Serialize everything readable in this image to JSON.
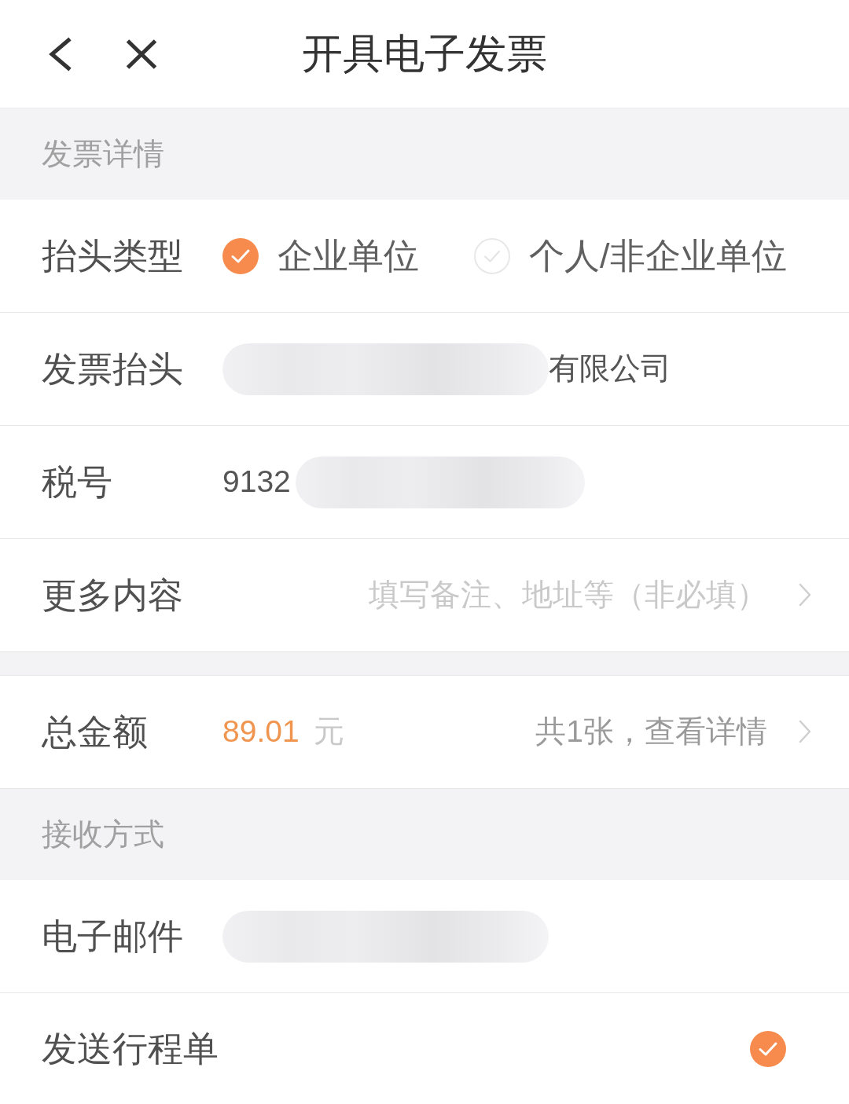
{
  "header": {
    "title": "开具电子发票"
  },
  "sections": [
    {
      "heading": "发票详情",
      "rows": [
        {
          "kind": "radio",
          "label": "抬头类型",
          "options": [
            {
              "label": "企业单位",
              "selected": true
            },
            {
              "label": "个人/非企业单位",
              "selected": false
            }
          ]
        },
        {
          "kind": "value",
          "label": "发票抬头",
          "value": [
            {
              "kind": "redaction"
            },
            {
              "kind": "text",
              "text": "有限公司"
            }
          ]
        },
        {
          "kind": "value",
          "label": "税号",
          "value": [
            {
              "kind": "text",
              "text": "9132"
            },
            {
              "kind": "redaction"
            }
          ]
        },
        {
          "kind": "link",
          "label": "更多内容",
          "hint": "填写备注、地址等（非必填）"
        }
      ]
    },
    {
      "rows": [
        {
          "kind": "amount",
          "label": "总金额",
          "amount": "89.01",
          "unit": "元",
          "detail": "共1张，查看详情"
        }
      ]
    },
    {
      "heading": "接收方式",
      "rows": [
        {
          "kind": "value",
          "label": "电子邮件",
          "value": [
            {
              "kind": "redaction"
            }
          ]
        },
        {
          "kind": "check",
          "label": "发送行程单",
          "checked": true
        }
      ]
    }
  ]
}
